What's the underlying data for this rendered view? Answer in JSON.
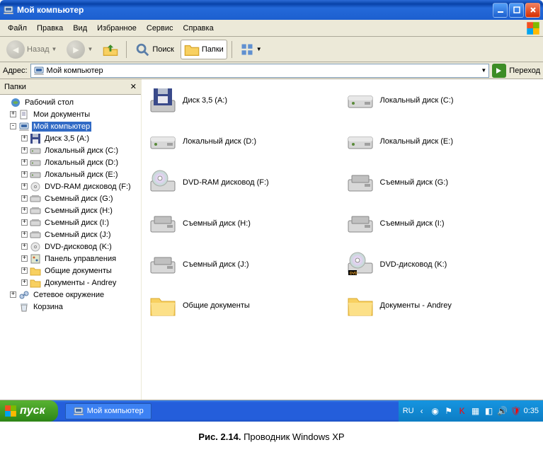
{
  "window": {
    "title": "Мой компьютер"
  },
  "menu": [
    "Файл",
    "Правка",
    "Вид",
    "Избранное",
    "Сервис",
    "Справка"
  ],
  "toolbar": {
    "back": "Назад",
    "search": "Поиск",
    "folders": "Папки"
  },
  "address": {
    "label": "Адрес:",
    "value": "Мой компьютер",
    "go": "Переход"
  },
  "pane": {
    "title": "Папки"
  },
  "tree": {
    "root": "Рабочий стол",
    "mydocs": "Мои документы",
    "mycomp": "Мой компьютер",
    "children": [
      "Диск 3,5 (A:)",
      "Локальный диск (C:)",
      "Локальный диск (D:)",
      "Локальный диск (E:)",
      "DVD-RAM дисковод (F:)",
      "Съемный диск (G:)",
      "Съемный диск (H:)",
      "Съемный диск (I:)",
      "Съемный диск (J:)",
      "DVD-дисковод (K:)",
      "Панель управления",
      "Общие документы",
      "Документы - Andrey"
    ],
    "network": "Сетевое окружение",
    "recycle": "Корзина"
  },
  "items": [
    {
      "label": "Диск 3,5 (A:)",
      "icon": "floppy"
    },
    {
      "label": "Локальный диск (C:)",
      "icon": "hdd"
    },
    {
      "label": "Локальный диск (D:)",
      "icon": "hdd"
    },
    {
      "label": "Локальный диск (E:)",
      "icon": "hdd"
    },
    {
      "label": "DVD-RAM дисковод (F:)",
      "icon": "dvd"
    },
    {
      "label": "Съемный диск (G:)",
      "icon": "removable"
    },
    {
      "label": "Съемный диск (H:)",
      "icon": "removable"
    },
    {
      "label": "Съемный диск (I:)",
      "icon": "removable"
    },
    {
      "label": "Съемный диск (J:)",
      "icon": "removable"
    },
    {
      "label": "DVD-дисковод (K:)",
      "icon": "dvd-disc"
    },
    {
      "label": "Общие документы",
      "icon": "folder"
    },
    {
      "label": "Документы - Andrey",
      "icon": "folder"
    }
  ],
  "taskbar": {
    "start": "пуск",
    "task": "Мой компьютер",
    "lang": "RU",
    "time": "0:35"
  },
  "caption": {
    "bold": "Рис. 2.14.",
    "text": "Проводник Windows XP"
  }
}
